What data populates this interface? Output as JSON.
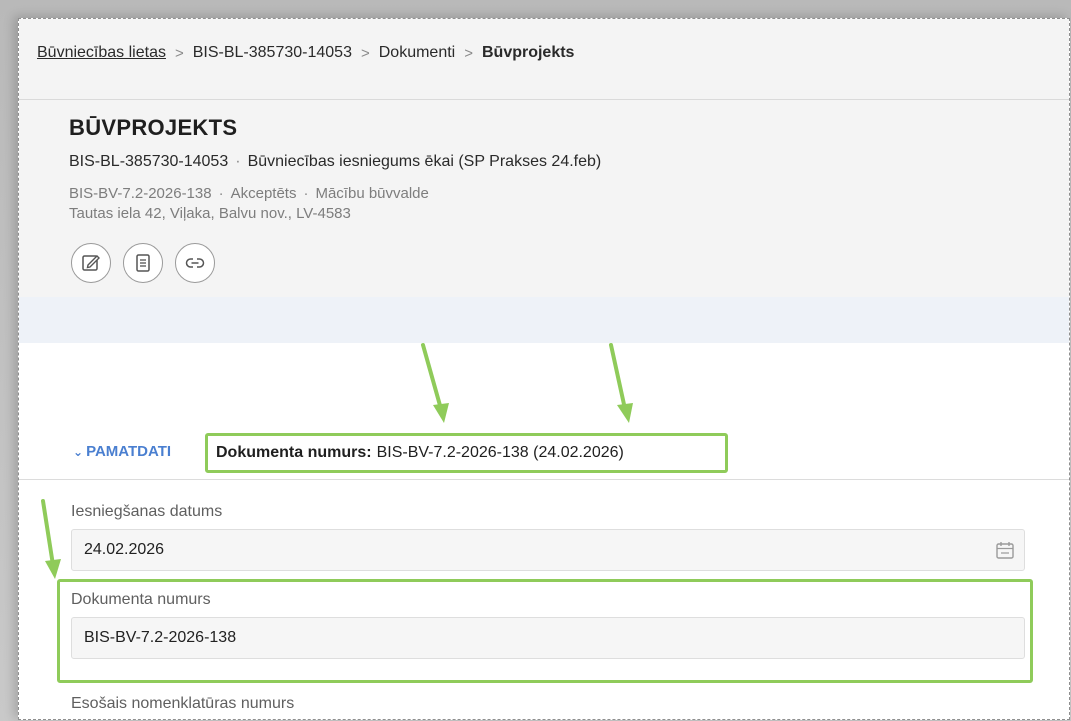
{
  "breadcrumb": {
    "items": [
      "Būvniecības lietas",
      "BIS-BL-385730-14053",
      "Dokumenti"
    ],
    "current": "Būvprojekts",
    "separator": ">"
  },
  "page": {
    "title": "BŪVPROJEKTS",
    "case_id": "BIS-BL-385730-14053",
    "case_name": "Būvniecības iesniegums ēkai (SP Prakses 24.feb)",
    "doc_number": "BIS-BV-7.2-2026-138",
    "status": "Akceptēts",
    "authority": "Mācību būvvalde",
    "address": "Tautas iela 42, Viļaka, Balvu nov., LV-4583",
    "separator": "·"
  },
  "actions": {
    "edit_icon": "edit-icon",
    "document_icon": "document-icon",
    "link_icon": "link-icon"
  },
  "section": {
    "toggle_label": "PAMATDATI",
    "summary_label": "Dokumenta numurs:",
    "summary_value": "BIS-BV-7.2-2026-138 (24.02.2026)"
  },
  "fields": {
    "submission_date_label": "Iesniegšanas datums",
    "submission_date_value": "24.02.2026",
    "document_number_label": "Dokumenta numurs",
    "document_number_value": "BIS-BV-7.2-2026-138",
    "nomenclature_label": "Esošais nomenklatūras numurs"
  },
  "colors": {
    "highlight": "#8fcb5a",
    "arrow": "#8fcb5a",
    "accent_link": "#4a7fd0",
    "band": "#eef2f8"
  }
}
